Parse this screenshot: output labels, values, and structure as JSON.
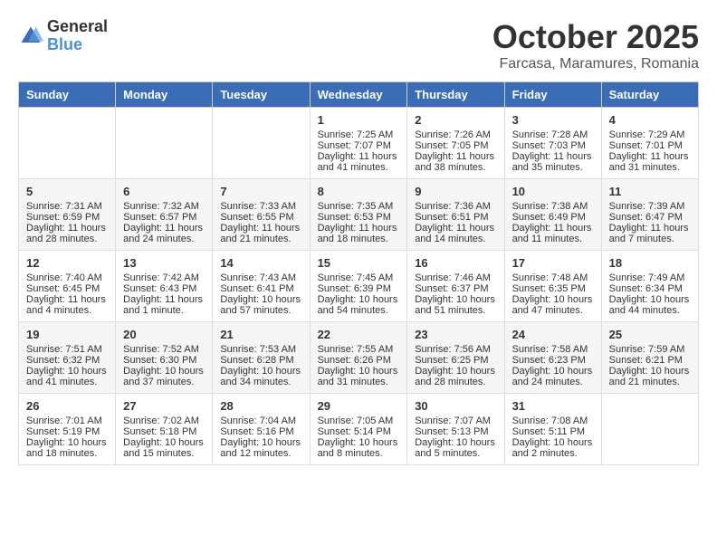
{
  "logo": {
    "text_general": "General",
    "text_blue": "Blue"
  },
  "header": {
    "month": "October 2025",
    "location": "Farcasa, Maramures, Romania"
  },
  "columns": [
    "Sunday",
    "Monday",
    "Tuesday",
    "Wednesday",
    "Thursday",
    "Friday",
    "Saturday"
  ],
  "weeks": [
    [
      {
        "day": "",
        "info": ""
      },
      {
        "day": "",
        "info": ""
      },
      {
        "day": "",
        "info": ""
      },
      {
        "day": "1",
        "info": "Sunrise: 7:25 AM\nSunset: 7:07 PM\nDaylight: 11 hours\nand 41 minutes."
      },
      {
        "day": "2",
        "info": "Sunrise: 7:26 AM\nSunset: 7:05 PM\nDaylight: 11 hours\nand 38 minutes."
      },
      {
        "day": "3",
        "info": "Sunrise: 7:28 AM\nSunset: 7:03 PM\nDaylight: 11 hours\nand 35 minutes."
      },
      {
        "day": "4",
        "info": "Sunrise: 7:29 AM\nSunset: 7:01 PM\nDaylight: 11 hours\nand 31 minutes."
      }
    ],
    [
      {
        "day": "5",
        "info": "Sunrise: 7:31 AM\nSunset: 6:59 PM\nDaylight: 11 hours\nand 28 minutes."
      },
      {
        "day": "6",
        "info": "Sunrise: 7:32 AM\nSunset: 6:57 PM\nDaylight: 11 hours\nand 24 minutes."
      },
      {
        "day": "7",
        "info": "Sunrise: 7:33 AM\nSunset: 6:55 PM\nDaylight: 11 hours\nand 21 minutes."
      },
      {
        "day": "8",
        "info": "Sunrise: 7:35 AM\nSunset: 6:53 PM\nDaylight: 11 hours\nand 18 minutes."
      },
      {
        "day": "9",
        "info": "Sunrise: 7:36 AM\nSunset: 6:51 PM\nDaylight: 11 hours\nand 14 minutes."
      },
      {
        "day": "10",
        "info": "Sunrise: 7:38 AM\nSunset: 6:49 PM\nDaylight: 11 hours\nand 11 minutes."
      },
      {
        "day": "11",
        "info": "Sunrise: 7:39 AM\nSunset: 6:47 PM\nDaylight: 11 hours\nand 7 minutes."
      }
    ],
    [
      {
        "day": "12",
        "info": "Sunrise: 7:40 AM\nSunset: 6:45 PM\nDaylight: 11 hours\nand 4 minutes."
      },
      {
        "day": "13",
        "info": "Sunrise: 7:42 AM\nSunset: 6:43 PM\nDaylight: 11 hours\nand 1 minute."
      },
      {
        "day": "14",
        "info": "Sunrise: 7:43 AM\nSunset: 6:41 PM\nDaylight: 10 hours\nand 57 minutes."
      },
      {
        "day": "15",
        "info": "Sunrise: 7:45 AM\nSunset: 6:39 PM\nDaylight: 10 hours\nand 54 minutes."
      },
      {
        "day": "16",
        "info": "Sunrise: 7:46 AM\nSunset: 6:37 PM\nDaylight: 10 hours\nand 51 minutes."
      },
      {
        "day": "17",
        "info": "Sunrise: 7:48 AM\nSunset: 6:35 PM\nDaylight: 10 hours\nand 47 minutes."
      },
      {
        "day": "18",
        "info": "Sunrise: 7:49 AM\nSunset: 6:34 PM\nDaylight: 10 hours\nand 44 minutes."
      }
    ],
    [
      {
        "day": "19",
        "info": "Sunrise: 7:51 AM\nSunset: 6:32 PM\nDaylight: 10 hours\nand 41 minutes."
      },
      {
        "day": "20",
        "info": "Sunrise: 7:52 AM\nSunset: 6:30 PM\nDaylight: 10 hours\nand 37 minutes."
      },
      {
        "day": "21",
        "info": "Sunrise: 7:53 AM\nSunset: 6:28 PM\nDaylight: 10 hours\nand 34 minutes."
      },
      {
        "day": "22",
        "info": "Sunrise: 7:55 AM\nSunset: 6:26 PM\nDaylight: 10 hours\nand 31 minutes."
      },
      {
        "day": "23",
        "info": "Sunrise: 7:56 AM\nSunset: 6:25 PM\nDaylight: 10 hours\nand 28 minutes."
      },
      {
        "day": "24",
        "info": "Sunrise: 7:58 AM\nSunset: 6:23 PM\nDaylight: 10 hours\nand 24 minutes."
      },
      {
        "day": "25",
        "info": "Sunrise: 7:59 AM\nSunset: 6:21 PM\nDaylight: 10 hours\nand 21 minutes."
      }
    ],
    [
      {
        "day": "26",
        "info": "Sunrise: 7:01 AM\nSunset: 5:19 PM\nDaylight: 10 hours\nand 18 minutes."
      },
      {
        "day": "27",
        "info": "Sunrise: 7:02 AM\nSunset: 5:18 PM\nDaylight: 10 hours\nand 15 minutes."
      },
      {
        "day": "28",
        "info": "Sunrise: 7:04 AM\nSunset: 5:16 PM\nDaylight: 10 hours\nand 12 minutes."
      },
      {
        "day": "29",
        "info": "Sunrise: 7:05 AM\nSunset: 5:14 PM\nDaylight: 10 hours\nand 8 minutes."
      },
      {
        "day": "30",
        "info": "Sunrise: 7:07 AM\nSunset: 5:13 PM\nDaylight: 10 hours\nand 5 minutes."
      },
      {
        "day": "31",
        "info": "Sunrise: 7:08 AM\nSunset: 5:11 PM\nDaylight: 10 hours\nand 2 minutes."
      },
      {
        "day": "",
        "info": ""
      }
    ]
  ]
}
